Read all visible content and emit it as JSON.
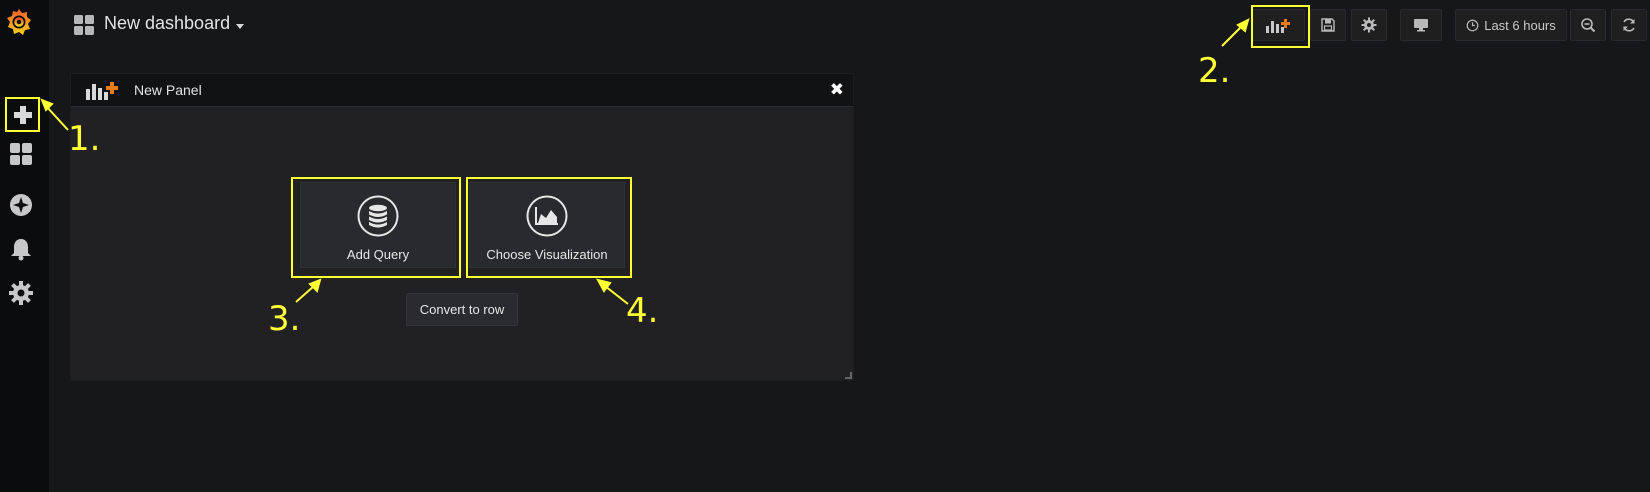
{
  "header": {
    "dashboard_title": "New dashboard",
    "time_range_label": "Last 6 hours",
    "icons": [
      "add-panel-icon",
      "save-icon",
      "gear-icon",
      "monitor-icon",
      "clock-icon",
      "zoom-out-icon",
      "refresh-icon"
    ]
  },
  "sidebar": {
    "items": [
      "grafana-logo",
      "plus-icon",
      "dashboards-icon",
      "explore-icon",
      "bell-icon",
      "gear-icon"
    ]
  },
  "panel": {
    "title": "New Panel",
    "close_symbol": "✖",
    "add_query_label": "Add Query",
    "choose_viz_label": "Choose Visualization",
    "convert_label": "Convert to row"
  },
  "annotations": {
    "labels": [
      "1.",
      "2.",
      "3.",
      "4."
    ],
    "color": "#ffff33"
  },
  "colors": {
    "background": "#161719",
    "sidebar": "#0b0c0e",
    "panel": "#212124",
    "accent_orange": "#eb7b18",
    "highlight": "#ffff33"
  }
}
